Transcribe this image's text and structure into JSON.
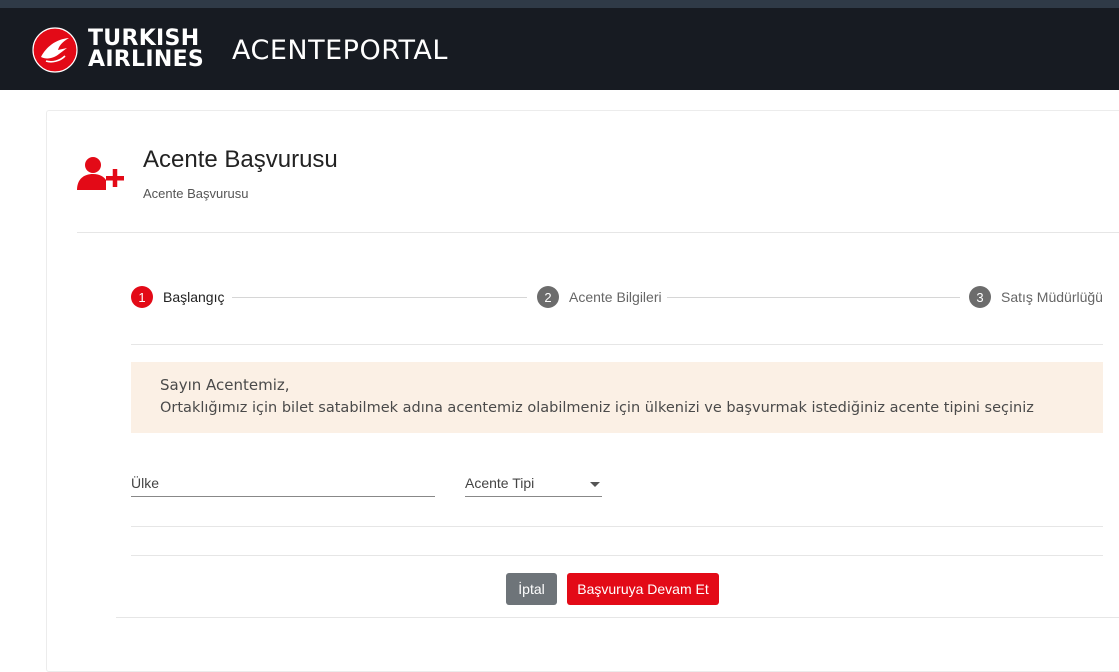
{
  "header": {
    "brand_line1": "TURKISH",
    "brand_line2": "AIRLINES",
    "portal_name": "ACENTEPORTAL",
    "brand_color": "#e30a17",
    "bar_color": "#171b22"
  },
  "page": {
    "title": "Acente Başvurusu",
    "subtitle": "Acente Başvurusu",
    "icon": "user-add-icon"
  },
  "steps": [
    {
      "num": "1",
      "label": "Başlangıç"
    },
    {
      "num": "2",
      "label": "Acente Bilgileri"
    },
    {
      "num": "3",
      "label": "Satış Müdürlüğü"
    }
  ],
  "active_step": 1,
  "alert": {
    "title": "Sayın Acentemiz,",
    "text": "Ortaklığımız için bilet satabilmek adına acentemiz olabilmeniz için ülkenizi ve başvurmak istediğiniz acente tipini seçiniz"
  },
  "form": {
    "country_label": "Ülke",
    "agency_type_label": "Acente Tipi"
  },
  "buttons": {
    "cancel": "İptal",
    "continue": "Başvuruya Devam Et"
  }
}
